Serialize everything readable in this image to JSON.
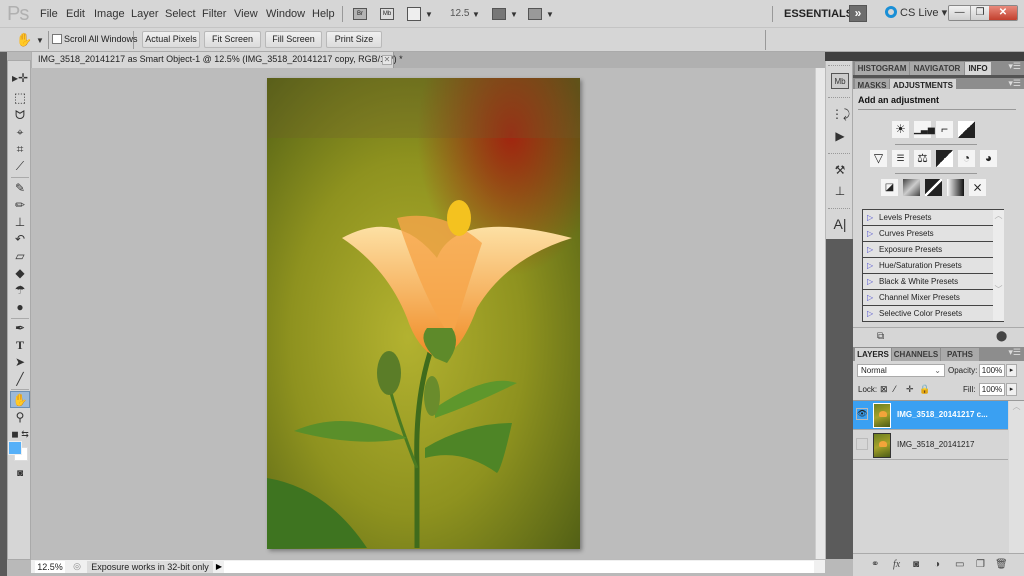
{
  "app": {
    "logo": "Ps"
  },
  "menu": [
    "File",
    "Edit",
    "Image",
    "Layer",
    "Select",
    "Filter",
    "View",
    "Window",
    "Help"
  ],
  "appbar": {
    "bridge_label": "Br",
    "minibridge_label": "Mb",
    "zoom_value": "12.5",
    "workspace": "ESSENTIALS",
    "extend_label": "»",
    "cslive": "CS Live ▾",
    "win_minimize": "—",
    "win_restore": "❐",
    "win_close": "✕"
  },
  "options": {
    "scroll_all_label": "Scroll All Windows",
    "scroll_all_checked": false,
    "buttons": [
      "Actual Pixels",
      "Fit Screen",
      "Fill Screen",
      "Print Size"
    ]
  },
  "document": {
    "tab_title": "IMG_3518_20141217 as Smart Object-1 @ 12.5% (IMG_3518_20141217 copy, RGB/16*) *",
    "close": "✕"
  },
  "status": {
    "zoom": "12.5%",
    "message": "Exposure works in 32-bit only",
    "arrow": "▶"
  },
  "colors": {
    "foreground": "#56b0f8",
    "background": "#ffffff",
    "selection": "#3aa0f2"
  },
  "panels": {
    "top_tabs": [
      "HISTOGRAM",
      "NAVIGATOR",
      "INFO"
    ],
    "top_active": "INFO",
    "adj_tabs": [
      "MASKS",
      "ADJUSTMENTS"
    ],
    "adj_active": "ADJUSTMENTS",
    "add_adjustment": "Add an adjustment",
    "presets": [
      "Levels Presets",
      "Curves Presets",
      "Exposure Presets",
      "Hue/Saturation Presets",
      "Black & White Presets",
      "Channel Mixer Presets",
      "Selective Color Presets"
    ],
    "layer_tabs": [
      "LAYERS",
      "CHANNELS",
      "PATHS"
    ],
    "layer_active": "LAYERS",
    "blend_mode": "Normal",
    "opacity_label": "Opacity:",
    "opacity": "100%",
    "lock_label": "Lock:",
    "fill_label": "Fill:",
    "fill": "100%",
    "layers": [
      {
        "name": "IMG_3518_20141217 c...",
        "visible": true,
        "selected": true
      },
      {
        "name": "IMG_3518_20141217",
        "visible": false,
        "selected": false
      }
    ]
  }
}
